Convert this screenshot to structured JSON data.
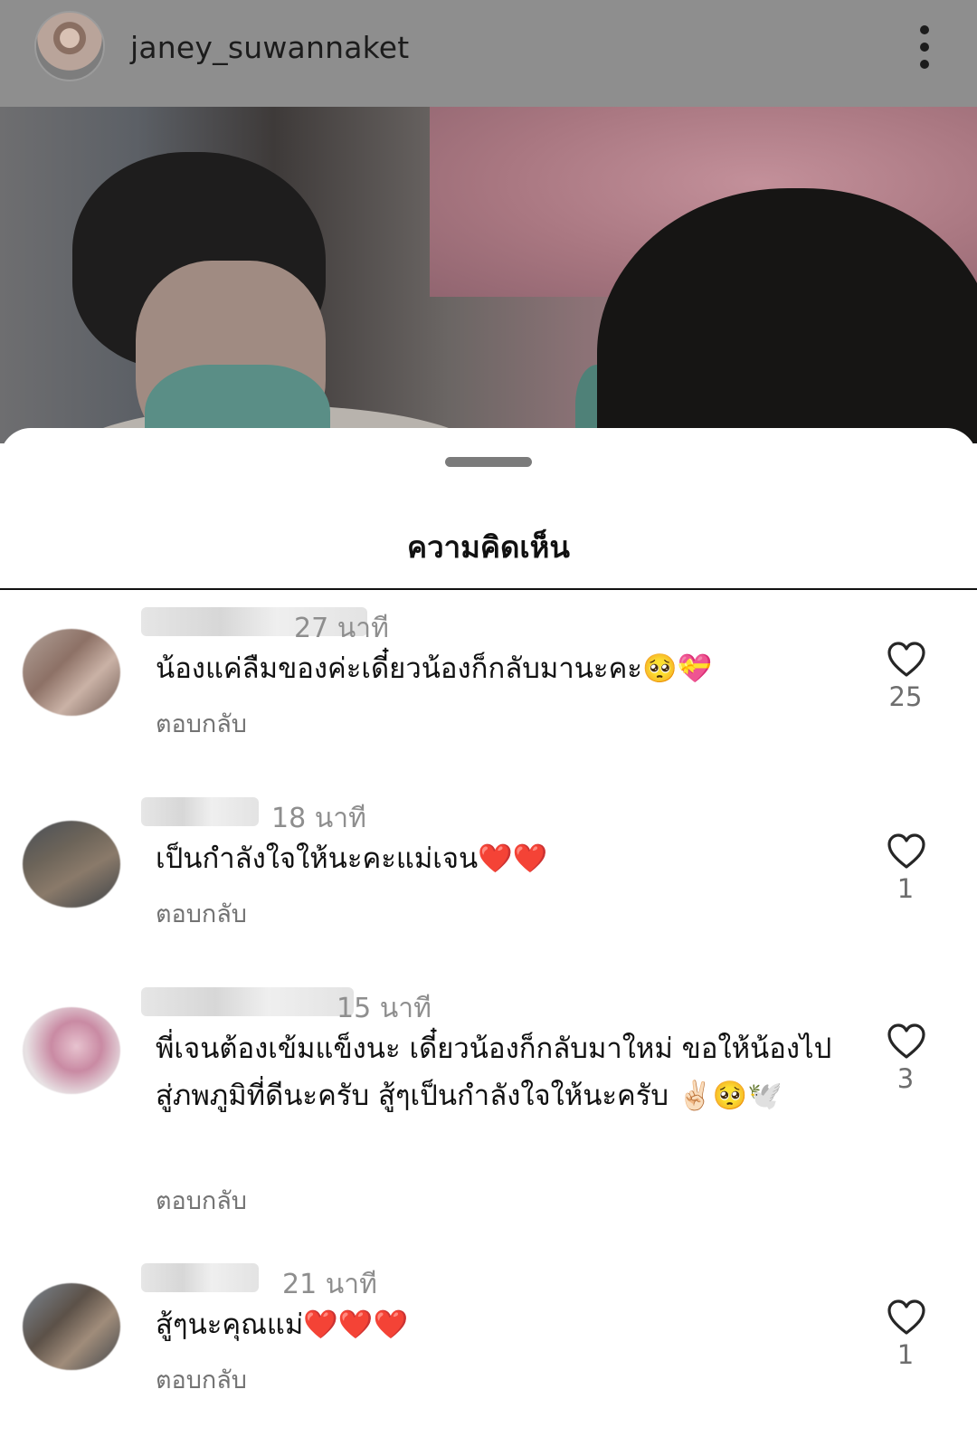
{
  "header": {
    "username": "janey_suwannaket",
    "more_icon": "more-vertical-icon"
  },
  "sheet": {
    "title": "ความคิดเห็น"
  },
  "comments": [
    {
      "time": "27 นาที",
      "text": "น้องแค่ลืมของค่ะเดี๋ยวน้องก็กลับมานะคะ🥺💝",
      "reply_label": "ตอบกลับ",
      "likes": "25"
    },
    {
      "time": "18 นาที",
      "text": "เป็นกำลังใจให้นะคะแม่เจน❤️❤️",
      "reply_label": "ตอบกลับ",
      "likes": "1"
    },
    {
      "time": "15 นาที",
      "text": "พี่เจนต้องเข้มแข็งนะ เดี๋ยวน้องก็กลับมาใหม่ ขอให้น้องไปสู่ภพภูมิที่ดีนะครับ สู้ๆเป็นกำลังใจให้นะครับ ✌🏻🥺🕊️",
      "reply_label": "ตอบกลับ",
      "likes": "3"
    },
    {
      "time": "21 นาที",
      "text": "สู้ๆนะคุณแม่❤️❤️❤️",
      "reply_label": "ตอบกลับ",
      "likes": "1"
    }
  ],
  "colors": {
    "header_dim": "#8e8e8e",
    "text": "#111111",
    "secondary_text": "#8e8e8e",
    "heart_red": "#e0182d"
  },
  "icons": {
    "like": "heart-outline-icon",
    "avatar": "user-avatar"
  }
}
